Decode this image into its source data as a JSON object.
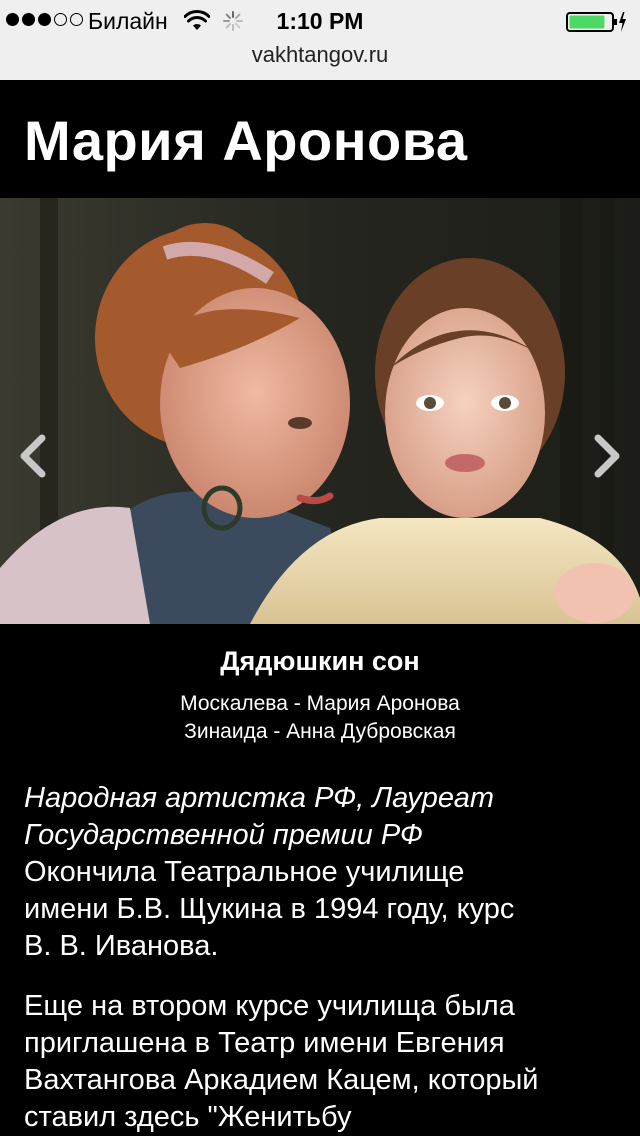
{
  "status_bar": {
    "carrier": "Билайн",
    "time": "1:10 PM",
    "signal_dots_filled": 3,
    "signal_dots_total": 5,
    "url": "vakhtangov.ru",
    "battery_level": 0.85,
    "icons": [
      "wifi-icon",
      "activity-spinner-icon",
      "battery-icon",
      "charging-bolt-icon"
    ]
  },
  "page": {
    "title": "Мария Аронова",
    "gallery": {
      "prev_icon": "chevron-left-icon",
      "next_icon": "chevron-right-icon",
      "caption_title": "Дядюшкин сон",
      "caption_lines": [
        "Москалева - Мария Аронова",
        "Зинаида - Анна Дубровская"
      ]
    },
    "bio": {
      "italic_line1": "Народная артистка РФ,  Лауреат",
      "italic_line2": "Государственной премии РФ",
      "para1_line1": "Окончила Театральное училище",
      "para1_line2": "имени Б.В.  Щукина в 1994 году, курс",
      "para1_line3": "В. В. Иванова.",
      "para2_line1": "Еще на втором курсе училища была",
      "para2_line2": "приглашена в Театр имени Евгения",
      "para2_line3": "Вахтангова Аркадием Кацем, который",
      "para2_line4": "ставил здесь \"Женитьбу"
    }
  },
  "colors": {
    "status_bg": "#efefef",
    "page_bg": "#000000",
    "text": "#ffffff",
    "battery": "#4cd964"
  }
}
